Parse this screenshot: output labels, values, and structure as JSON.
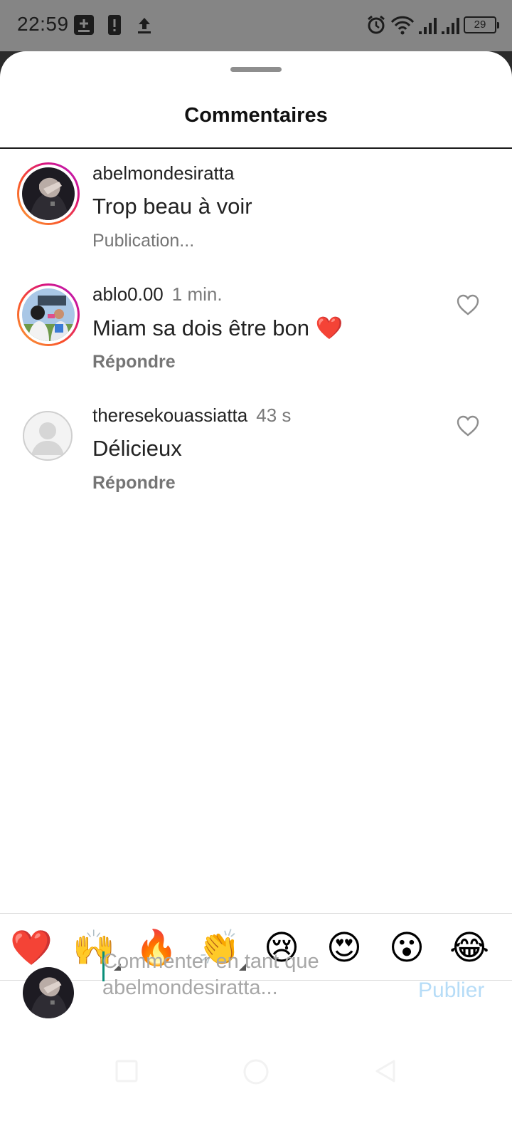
{
  "status_bar": {
    "time": "22:59",
    "battery": "29",
    "icons": [
      "add-box-icon",
      "sim-alert-icon",
      "upload-icon",
      "alarm-icon",
      "wifi-icon",
      "signal-icon",
      "signal-icon",
      "battery-icon"
    ]
  },
  "sheet": {
    "title": "Commentaires"
  },
  "comments": [
    {
      "username": "abelmondesiratta",
      "time": "",
      "text": "Trop beau à voir",
      "action": "Publication...",
      "has_story_ring": true,
      "liked": false
    },
    {
      "username": "ablo0.00",
      "time": "1 min.",
      "text": "Miam sa dois être bon ❤️",
      "action": "Répondre",
      "has_story_ring": true,
      "liked": false
    },
    {
      "username": "theresekouassiatta",
      "time": "43 s",
      "text": "Délicieux",
      "action": "Répondre",
      "has_story_ring": false,
      "liked": false
    }
  ],
  "emoji_bar": [
    "❤️",
    "🙌",
    "🔥",
    "👏",
    "😢",
    "😍",
    "😮",
    "😂"
  ],
  "composer": {
    "placeholder": "Commenter en tant que abelmondesiratta...",
    "publish_label": "Publier"
  },
  "colors": {
    "status_bar_bg": "#858585",
    "publish_disabled": "#b6dcf7",
    "caret": "#0a8f7a",
    "story_ring_start": "#f9a33a",
    "story_ring_end": "#b21fc8"
  }
}
